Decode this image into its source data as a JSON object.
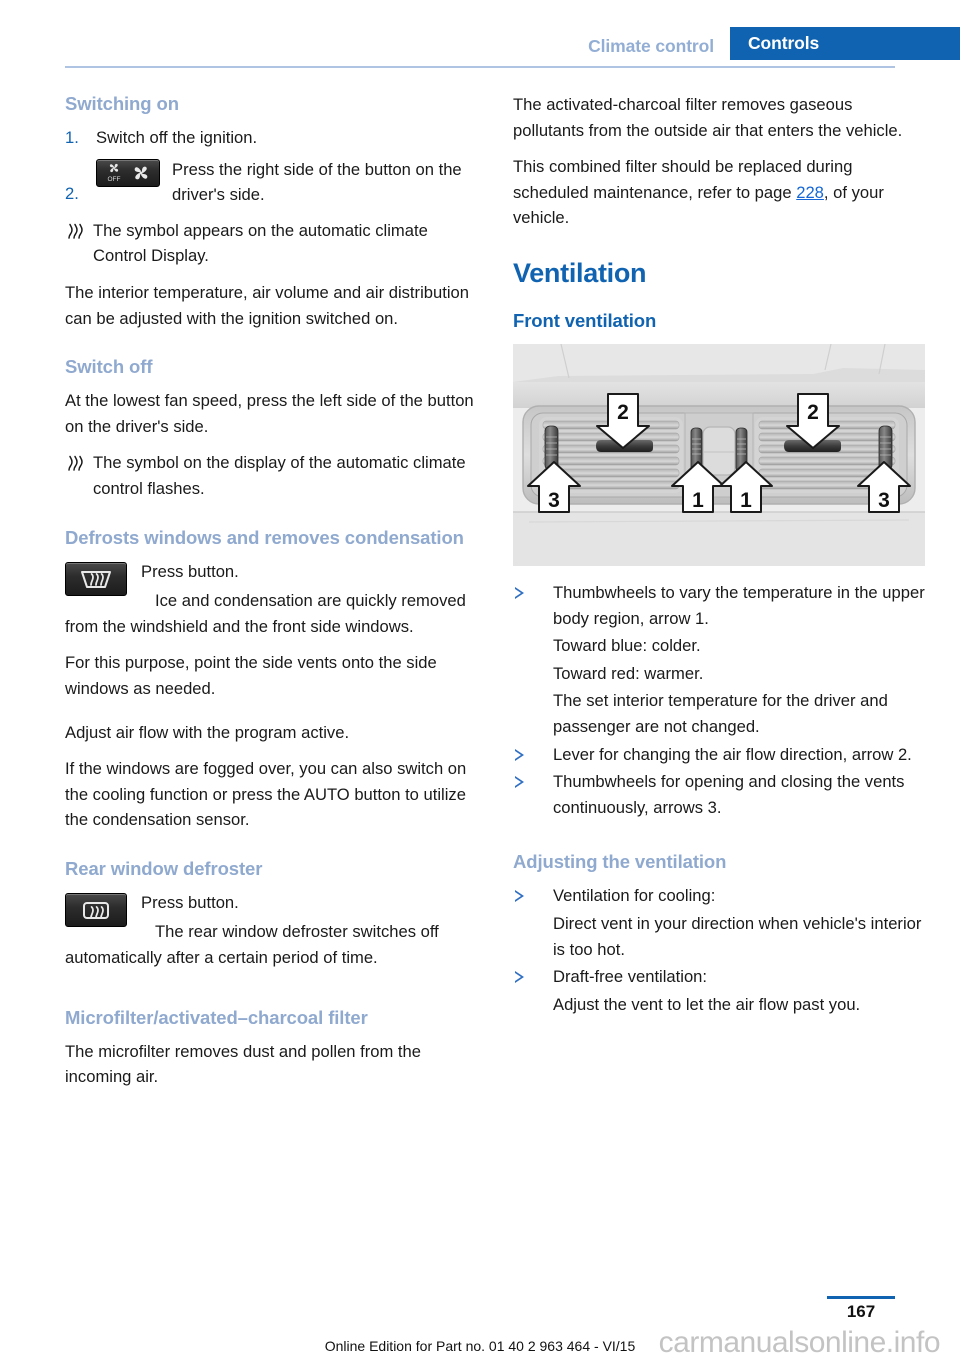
{
  "header": {
    "chapter": "Climate control",
    "section": "Controls"
  },
  "left_column": {
    "switching_on": {
      "heading": "Switching on",
      "steps": [
        {
          "num": "1.",
          "text": "Switch off the ignition."
        },
        {
          "num": "2.",
          "icon": "fan-off-fan-button-icon",
          "text": "Press the right side of the button on the driver's side."
        }
      ],
      "note": "The symbol appears on the automatic climate Control Display.",
      "note_icon": "heat-waves-symbol-icon",
      "paragraph": "The interior temperature, air volume and air distribution can be adjusted with the ignition switched on."
    },
    "switch_off": {
      "heading": "Switch off",
      "paragraph": "At the lowest fan speed, press the left side of the button on the driver's side.",
      "note_icon": "heat-waves-symbol-icon",
      "note": "The symbol on the display of the automatic climate control flashes."
    },
    "defrost": {
      "heading": "Defrosts windows and removes condensation",
      "icon": "windshield-defrost-button-icon",
      "press_button": "Press button.",
      "paragraph1": "Ice and condensation are quickly removed from the windshield and the front side windows.",
      "paragraph2": "For this purpose, point the side vents onto the side windows as needed.",
      "paragraph3": "Adjust air flow with the program active.",
      "paragraph4": "If the windows are fogged over, you can also switch on the cooling function or press the AUTO button to utilize the condensation sensor."
    },
    "rear_defroster": {
      "heading": "Rear window defroster",
      "icon": "rear-window-defrost-button-icon",
      "press_button": "Press button.",
      "paragraph": "The rear window defroster switches off automatically after a certain period of time."
    },
    "microfilter": {
      "heading": "Microfilter/activated–charcoal filter",
      "paragraph": "The microfilter removes dust and pollen from the incoming air."
    }
  },
  "right_column": {
    "charcoal_para1": "The activated-charcoal filter removes gaseous pollutants from the outside air that enters the vehicle.",
    "charcoal_para2_before": "This combined filter should be replaced during scheduled maintenance, refer to page ",
    "charcoal_page_ref": "228",
    "charcoal_para2_after": ", of your vehicle.",
    "ventilation": {
      "heading": "Ventilation",
      "front_heading": "Front ventilation",
      "figure": {
        "alt": "dashboard-center-air-vents-illustration",
        "callouts": [
          "2",
          "2",
          "1",
          "1",
          "3",
          "3"
        ]
      },
      "bullets": [
        {
          "text": "Thumbwheels to vary the temperature in the upper body region, arrow 1.",
          "sublines": [
            "Toward blue: colder.",
            "Toward red: warmer.",
            "The set interior temperature for the driver and passenger are not changed."
          ]
        },
        {
          "text": "Lever for changing the air flow direction, arrow 2.",
          "sublines": []
        },
        {
          "text": "Thumbwheels for opening and closing the vents continuously, arrows 3.",
          "sublines": []
        }
      ]
    },
    "adjusting": {
      "heading": "Adjusting the ventilation",
      "bullets": [
        {
          "text": "Ventilation for cooling:",
          "sublines": [
            "Direct vent in your direction when vehicle's interior is too hot."
          ]
        },
        {
          "text": "Draft-free ventilation:",
          "sublines": [
            "Adjust the vent to let the air flow past you."
          ]
        }
      ]
    }
  },
  "footer": {
    "page_number": "167",
    "edition": "Online Edition for Part no. 01 40 2 963 464 - VI/15",
    "watermark": "carmanualsonline.info"
  },
  "colors": {
    "header_blue": "#1063b0",
    "header_chapter": "#93aed4",
    "light_head": "#8fa9cf",
    "link": "#1466d6",
    "rule": "#aec4e2"
  }
}
